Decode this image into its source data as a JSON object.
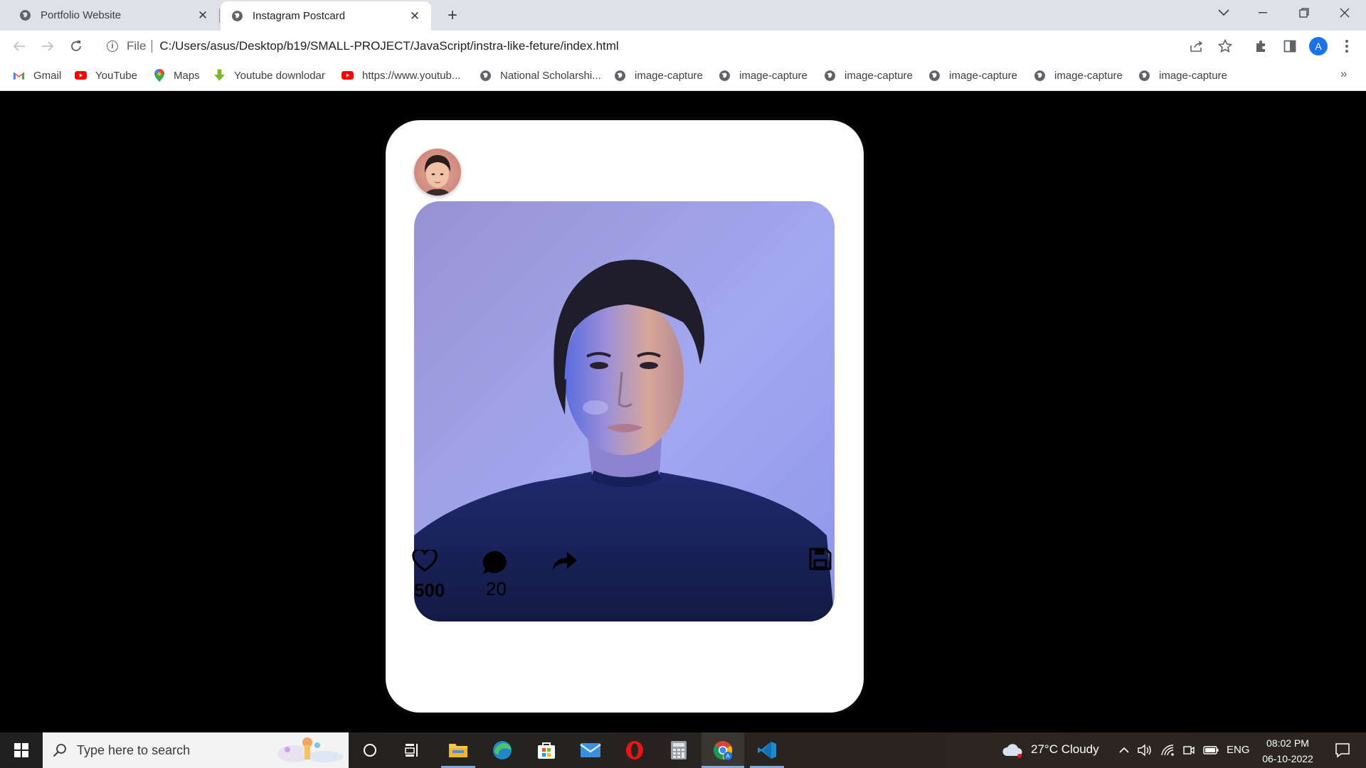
{
  "browser": {
    "tabs": [
      {
        "title": "Portfolio Website",
        "active": false
      },
      {
        "title": "Instagram Postcard",
        "active": true
      }
    ],
    "address": {
      "scheme_label": "File",
      "url": "C:/Users/asus/Desktop/b19/SMALL-PROJECT/JavaScript/instra-like-feture/index.html"
    },
    "profile_initial": "A",
    "bookmarks": [
      {
        "label": "Gmail",
        "icon": "gmail-icon"
      },
      {
        "label": "YouTube",
        "icon": "youtube-icon"
      },
      {
        "label": "Maps",
        "icon": "maps-icon"
      },
      {
        "label": "Youtube downlodar",
        "icon": "download-icon"
      },
      {
        "label": "https://www.youtub...",
        "icon": "youtube-icon"
      },
      {
        "label": "National Scholarshi...",
        "icon": "globe-icon"
      },
      {
        "label": "image-capture",
        "icon": "globe-icon"
      },
      {
        "label": "image-capture",
        "icon": "globe-icon"
      },
      {
        "label": "image-capture",
        "icon": "globe-icon"
      },
      {
        "label": "image-capture",
        "icon": "globe-icon"
      },
      {
        "label": "image-capture",
        "icon": "globe-icon"
      },
      {
        "label": "image-capture",
        "icon": "globe-icon"
      }
    ]
  },
  "post": {
    "likes": "500",
    "comments": "20",
    "icons": {
      "like": "heart-outline-icon",
      "comment": "comment-bubble-icon",
      "share": "share-arrow-icon",
      "save": "floppy-save-icon"
    }
  },
  "taskbar": {
    "search_placeholder": "Type here to search",
    "weather": "27°C  Cloudy",
    "language": "ENG",
    "time": "08:02 PM",
    "date": "06-10-2022"
  },
  "colors": {
    "page_background": "#000000",
    "card_background": "#ffffff",
    "photo_background": "#9a9fe6"
  }
}
